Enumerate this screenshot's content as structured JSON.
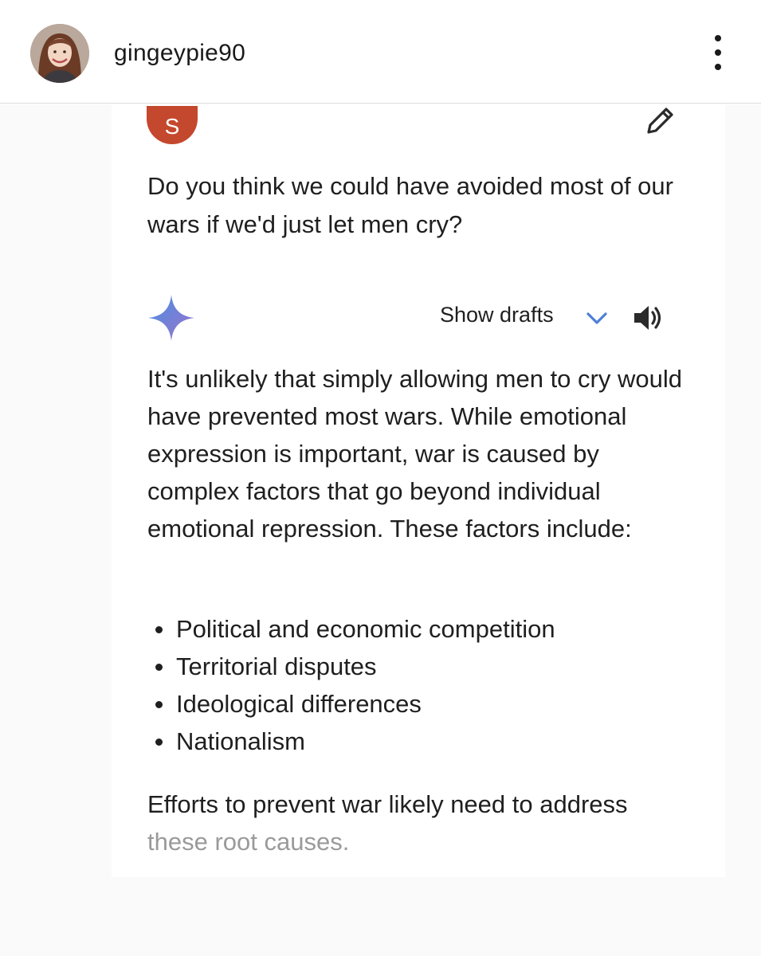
{
  "header": {
    "username": "gingeypie90",
    "avatar_icon": "profile-photo",
    "more_icon": "more-vertical-icon"
  },
  "chat": {
    "user_initial": "S",
    "user_badge_color": "#c4482d",
    "question": "Do you think we could have avoided most of our wars if we'd just let men cry?",
    "show_drafts_label": "Show drafts",
    "answer_intro": "It's unlikely that simply allowing men to cry would have prevented most wars. While emotional expression is important, war is caused by complex factors that go beyond individual emotional repression. These factors include:",
    "bullets": [
      "Political and economic competition",
      "Territorial disputes",
      "Ideological differences",
      "Nationalism"
    ],
    "closing_main": "Efforts to prevent war likely need to address",
    "closing_faded": "these root causes."
  },
  "colors": {
    "accent_blue": "#4f7fd6",
    "gemini_gradient_start": "#4a90e2",
    "gemini_gradient_end": "#9b72cb"
  }
}
